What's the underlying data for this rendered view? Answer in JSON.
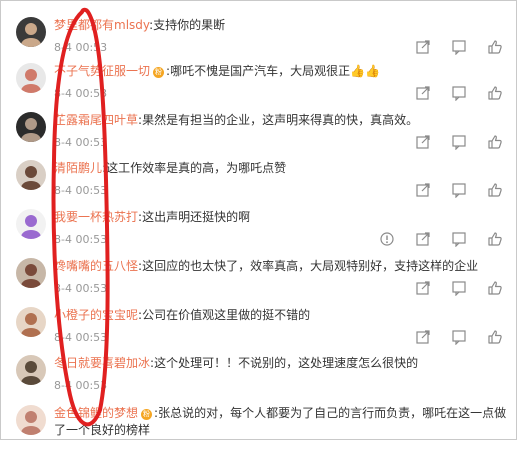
{
  "colors": {
    "username": "#eb7350",
    "timestamp": "#999999",
    "text": "#333333",
    "icon": "#8a8a8a",
    "annotation": "#e02020"
  },
  "comments": [
    {
      "user": "梦里都都有mlsdy",
      "has_badge": false,
      "text": "支持你的果断",
      "emoji": "",
      "time": "8-4 00:53",
      "actions": [
        "share-icon",
        "comment-icon",
        "like-icon"
      ]
    },
    {
      "user": "不子气势征服一切",
      "has_badge": true,
      "text": "哪吒不愧是国产汽车，大局观很正",
      "emoji": "👍👍",
      "time": "8-4 00:53",
      "actions": [
        "share-icon",
        "comment-icon",
        "like-icon"
      ]
    },
    {
      "user": "芷露霜尾四叶草",
      "has_badge": false,
      "text": "果然是有担当的企业，这声明来得真的快，真高效。",
      "emoji": "",
      "time": "8-4 00:53",
      "actions": [
        "share-icon",
        "comment-icon",
        "like-icon"
      ]
    },
    {
      "user": "清陌鹏儿",
      "has_badge": false,
      "text": "这工作效率是真的高，为哪吒点赞",
      "emoji": "",
      "time": "8-4 00:53",
      "actions": [
        "share-icon",
        "comment-icon",
        "like-icon"
      ]
    },
    {
      "user": "我要一杯热苏打",
      "has_badge": false,
      "text": "这出声明还挺快的啊",
      "emoji": "",
      "time": "8-4 00:53",
      "actions": [
        "report-icon",
        "share-icon",
        "comment-icon",
        "like-icon"
      ]
    },
    {
      "user": "馋嘴嘴的五八怪",
      "has_badge": false,
      "text": "这回应的也太快了，效率真高，大局观特别好，支持这样的企业",
      "emoji": "",
      "time": "8-4 00:53",
      "actions": [
        "share-icon",
        "comment-icon",
        "like-icon"
      ]
    },
    {
      "user": "小橙子的宝宝呢",
      "has_badge": false,
      "text": "公司在价值观这里做的挺不错的",
      "emoji": "",
      "time": "8-4 00:53",
      "actions": [
        "share-icon",
        "comment-icon",
        "like-icon"
      ]
    },
    {
      "user": "冬日就要喜碧加冰",
      "has_badge": false,
      "text": "这个处理可！！不说别的，这处理速度怎么很快的",
      "emoji": "",
      "time": "8-4 00:53",
      "actions": []
    },
    {
      "user": "金色锦鲤的梦想",
      "has_badge": true,
      "text": "张总说的对，每个人都要为了自己的言行而负责，哪吒在这一点做了一个良好的榜样",
      "emoji": "",
      "time": "",
      "actions": []
    }
  ]
}
